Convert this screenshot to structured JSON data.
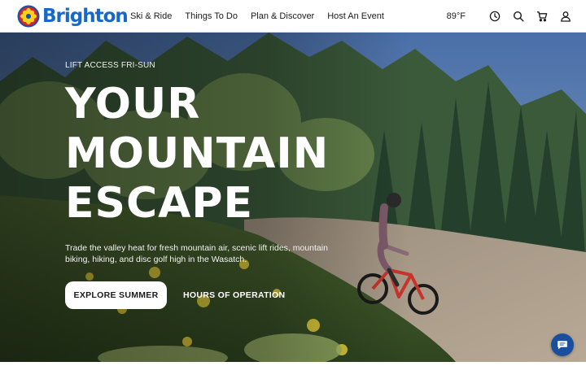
{
  "brand": {
    "name": "Brighton",
    "color": "#1768c9"
  },
  "nav": {
    "items": [
      {
        "label": "Ski & Ride"
      },
      {
        "label": "Things To Do"
      },
      {
        "label": "Plan & Discover"
      },
      {
        "label": "Host An Event"
      }
    ]
  },
  "utilities": {
    "temperature": "89°F",
    "icons": [
      "clock-icon",
      "search-icon",
      "cart-icon",
      "user-icon"
    ]
  },
  "hero": {
    "eyebrow": "LIFT ACCESS FRI-SUN",
    "headline": [
      "YOUR",
      "MOUNTAIN",
      "ESCAPE"
    ],
    "subcopy": "Trade the valley heat for fresh mountain air, scenic lift rides, mountain biking, hiking, and disc golf high in the Wasatch.",
    "primary_button": "EXPLORE SUMMER",
    "secondary_link": "HOURS OF OPERATION"
  },
  "chat": {
    "icon": "chat-icon",
    "color": "#1a4fa0"
  }
}
